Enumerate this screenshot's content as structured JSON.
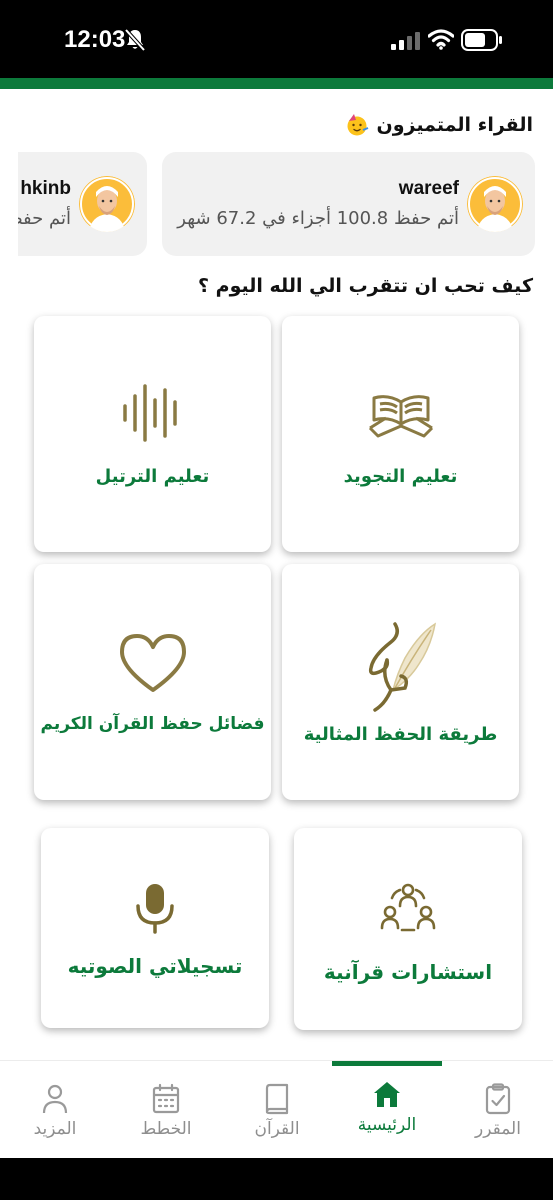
{
  "status_bar": {
    "time": "12:03"
  },
  "readers": {
    "title": "القراء المتميزون",
    "cards": [
      {
        "name": "wareef",
        "stat": "أتم حفظ 100.8 أجزاء في 67.2 شهر"
      },
      {
        "name": "hkinb",
        "stat": "أتم حفظ"
      }
    ]
  },
  "how": {
    "title": "كيف تحب ان تتقرب الي الله اليوم ؟",
    "tiles": [
      {
        "label": "تعليم التجويد",
        "icon": "quran-book-icon"
      },
      {
        "label": "تعليم الترتيل",
        "icon": "sound-wave-icon"
      },
      {
        "label": "طريقة الحفظ المثالية",
        "icon": "quill-pen-icon"
      },
      {
        "label": "فضائل حفظ  القرآن الكريم",
        "icon": "heart-icon"
      },
      {
        "label": "استشارات قرآنية",
        "icon": "group-consult-icon"
      },
      {
        "label": "تسجيلاتي الصوتيه",
        "icon": "microphone-icon"
      }
    ]
  },
  "bottom_nav": {
    "items": [
      {
        "label": "المقرر",
        "icon": "clipboard-check-icon"
      },
      {
        "label": "الرئيسية",
        "icon": "home-icon",
        "active": true
      },
      {
        "label": "القرآن",
        "icon": "book-icon"
      },
      {
        "label": "الخطط",
        "icon": "calendar-icon"
      },
      {
        "label": "المزيد",
        "icon": "user-icon"
      }
    ]
  },
  "colors": {
    "brand_green": "#0c7a3b",
    "icon_gold": "#8a7a43",
    "inactive_gray": "#8e8e8e"
  }
}
